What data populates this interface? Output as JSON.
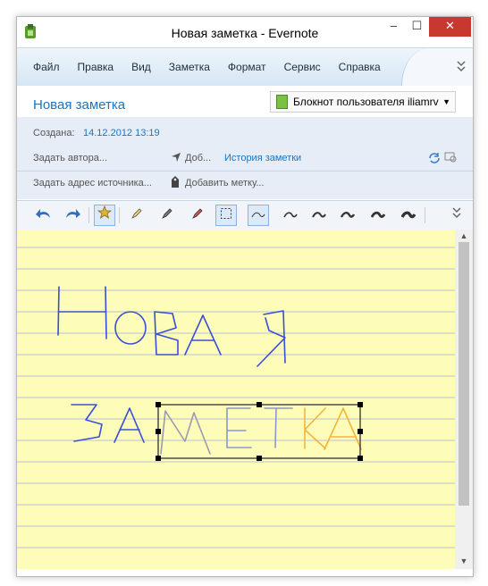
{
  "window": {
    "title": "Новая заметка - Evernote",
    "controls": {
      "minimize": "–",
      "maximize": "☐",
      "close": "✕"
    }
  },
  "menu": {
    "items": [
      "Файл",
      "Правка",
      "Вид",
      "Заметка",
      "Формат",
      "Сервис",
      "Справка"
    ],
    "more": "»"
  },
  "note": {
    "title": "Новая заметка",
    "notebook": "Блокнот пользователя iliamrv"
  },
  "meta": {
    "created_label": "Создана:",
    "created_value": "14.12.2012 13:19",
    "author_placeholder": "Задать автора...",
    "location_short": "Доб...",
    "history_link": "История заметки",
    "source_placeholder": "Задать адрес источника...",
    "add_tag": "Добавить метку..."
  },
  "colors": {
    "accent": "#1e73be",
    "paper": "#fdfcb8",
    "ink_blue": "#3b4ed8",
    "ink_grey": "#9a9ab4",
    "ink_orange": "#f5b33b"
  },
  "toolbar": {
    "icons": [
      "undo-icon",
      "redo-icon",
      "star-tool-icon",
      "highlighter-icon",
      "pen-icon",
      "marker-icon",
      "select-rect-icon",
      "stroke-thin-icon",
      "stroke-2-icon",
      "stroke-3-icon",
      "stroke-4-icon",
      "stroke-5-icon",
      "stroke-6-icon",
      "toolbar-more-icon"
    ]
  },
  "handwriting": {
    "line1": "Новая",
    "line2": "заметка"
  }
}
